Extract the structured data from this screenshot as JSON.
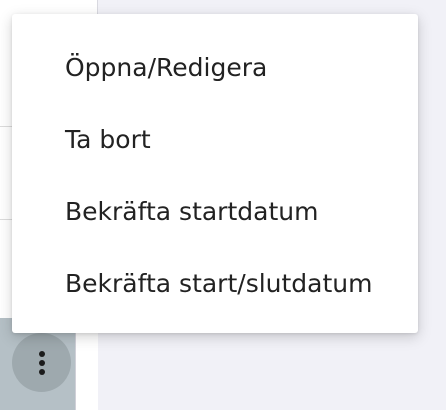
{
  "menu": {
    "items": [
      {
        "label": "Öppna/Redigera"
      },
      {
        "label": "Ta bort"
      },
      {
        "label": "Bekräfta startdatum"
      },
      {
        "label": "Bekräfta start/slutdatum"
      }
    ]
  },
  "colors": {
    "background": "#f1f1f7",
    "row_highlight": "#b5c0c6",
    "kebab_button": "#9ea9ae",
    "menu_text": "#222222"
  },
  "icons": {
    "kebab": "more-vertical-icon"
  }
}
